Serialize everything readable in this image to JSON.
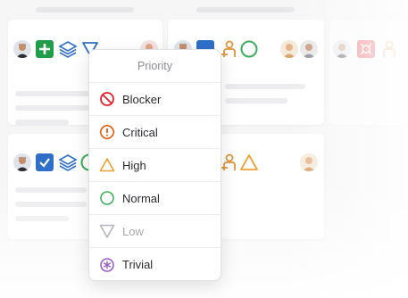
{
  "priority_menu": {
    "title": "Priority",
    "options": [
      {
        "label": "Blocker",
        "icon": "blocker-icon",
        "color": "#e5202a"
      },
      {
        "label": "Critical",
        "icon": "critical-icon",
        "color": "#e05a12"
      },
      {
        "label": "High",
        "icon": "high-icon",
        "color": "#f0a030"
      },
      {
        "label": "Normal",
        "icon": "normal-icon",
        "color": "#3cae5c"
      },
      {
        "label": "Low",
        "icon": "low-icon",
        "color": "#b5b5bb"
      },
      {
        "label": "Trivial",
        "icon": "trivial-icon",
        "color": "#9a5fc6"
      }
    ]
  },
  "colors": {
    "card_add_green": "#1f9d48",
    "card_check_blue": "#2f6fc9",
    "layers_blue": "#2f6fc9",
    "filter_blue": "#2f6fc9",
    "assign_orange": "#e0953a",
    "normal_green": "#3cae5c",
    "red_square": "#e5202a"
  }
}
